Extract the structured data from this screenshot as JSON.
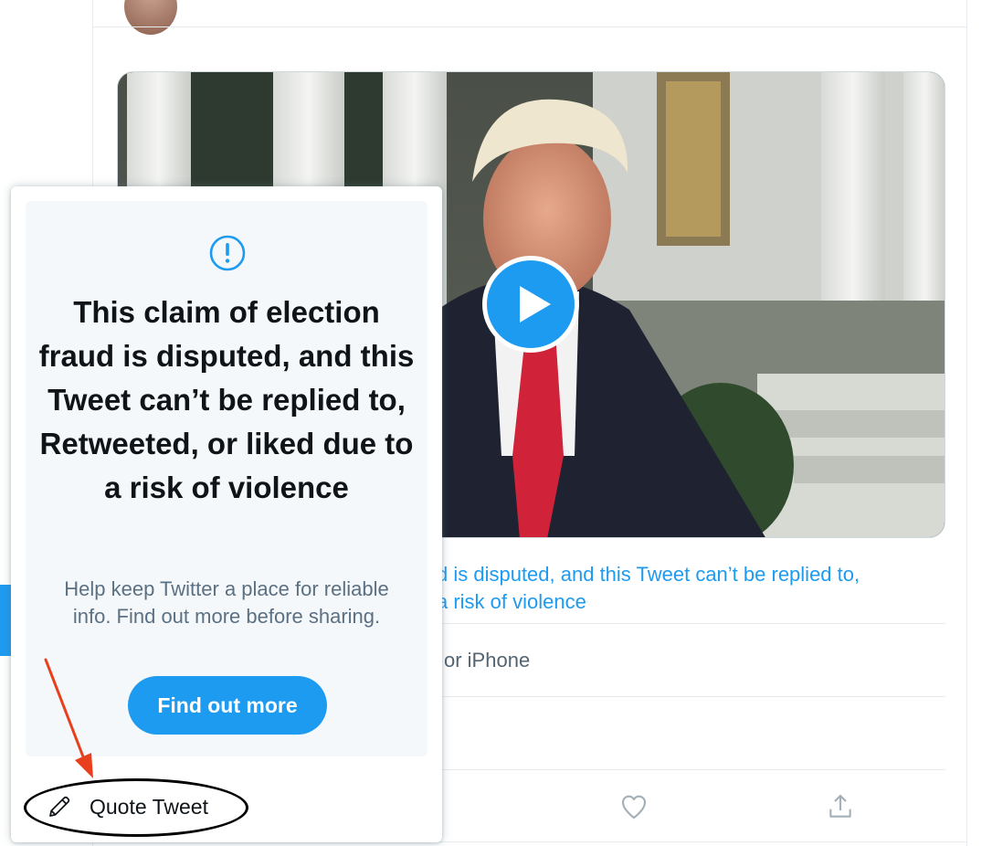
{
  "popup": {
    "warning_icon": "exclamation-circle-icon",
    "title": "This claim of election fraud is disputed, and this Tweet can’t be replied to, Retweeted, or liked due to a risk of violence",
    "body": "Help keep Twitter a place for reliable info. Find out more before sharing.",
    "button_label": "Find out more",
    "quote_tweet": {
      "icon": "pencil-icon",
      "label": "Quote Tweet"
    }
  },
  "tweet": {
    "media": {
      "play_icon": "play-icon"
    },
    "label_line_1": "d is disputed, and this Tweet can’t be replied to,",
    "label_line_2": "a risk of violence",
    "source_text": "or iPhone",
    "actions": {
      "like_icon": "heart-icon",
      "share_icon": "share-icon"
    }
  },
  "colors": {
    "accent": "#1d9bf0",
    "text_primary": "#0f1419",
    "text_secondary": "#5b7083",
    "annotation_arrow": "#e8401c",
    "annotation_ellipse": "#000000"
  }
}
